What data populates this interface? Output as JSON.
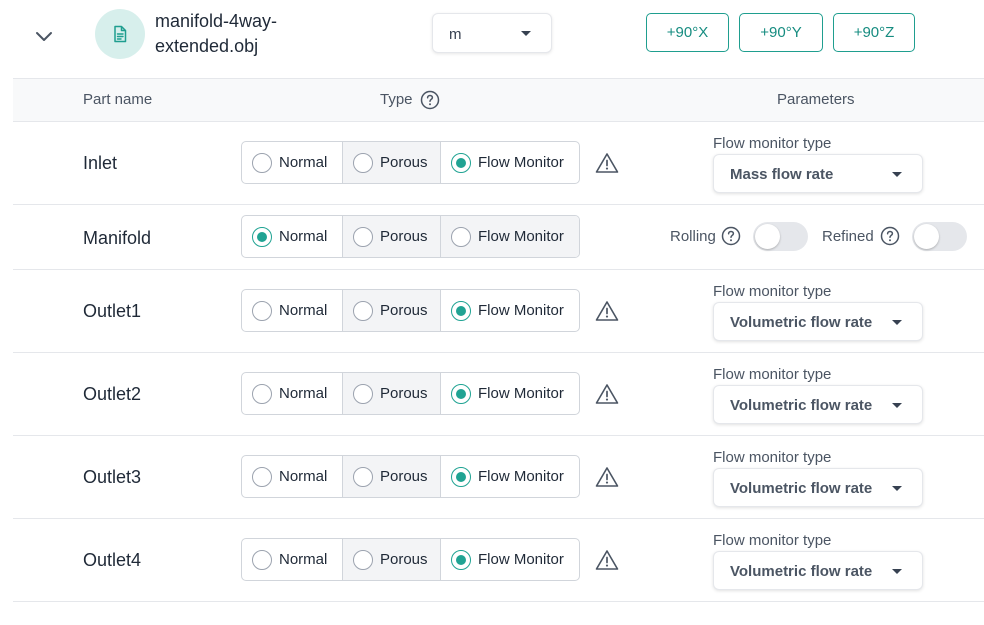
{
  "file": {
    "name": "manifold-4way-extended.obj",
    "icon": "document-icon",
    "unit_value": "m",
    "rotate_buttons": [
      "+90°X",
      "+90°Y",
      "+90°Z"
    ]
  },
  "table": {
    "headers": {
      "part_name": "Part name",
      "type": "Type",
      "parameters": "Parameters"
    },
    "type_options": [
      "Normal",
      "Porous",
      "Flow Monitor"
    ],
    "rows": [
      {
        "part": "Inlet",
        "selected_type": "Flow Monitor",
        "warning": true,
        "param_label": "Flow monitor type",
        "param_value": "Mass flow rate"
      },
      {
        "part": "Manifold",
        "selected_type": "Normal",
        "warning": false,
        "rolling_label": "Rolling",
        "rolling_on": false,
        "refined_label": "Refined",
        "refined_on": false
      },
      {
        "part": "Outlet1",
        "selected_type": "Flow Monitor",
        "warning": true,
        "param_label": "Flow monitor type",
        "param_value": "Volumetric flow rate"
      },
      {
        "part": "Outlet2",
        "selected_type": "Flow Monitor",
        "warning": true,
        "param_label": "Flow monitor type",
        "param_value": "Volumetric flow rate"
      },
      {
        "part": "Outlet3",
        "selected_type": "Flow Monitor",
        "warning": true,
        "param_label": "Flow monitor type",
        "param_value": "Volumetric flow rate"
      },
      {
        "part": "Outlet4",
        "selected_type": "Flow Monitor",
        "warning": true,
        "param_label": "Flow monitor type",
        "param_value": "Volumetric flow rate"
      }
    ]
  },
  "colors": {
    "accent": "#20a393",
    "accent_text": "#168c80",
    "icon_bg": "#d7efec",
    "disabled_option_bg": "#f3f4f6"
  }
}
